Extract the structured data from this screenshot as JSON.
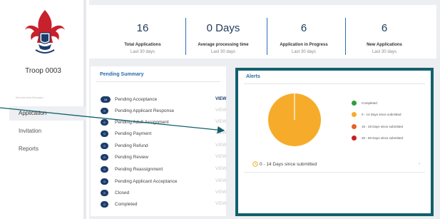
{
  "sidebar": {
    "troop_name": "Troop 0003",
    "section_label": "Membership Manager",
    "items": [
      {
        "label": "Application",
        "active": true
      },
      {
        "label": "Invitation",
        "active": false
      },
      {
        "label": "Reports",
        "active": false
      }
    ]
  },
  "stats": [
    {
      "value": "16",
      "label": "Total Applications",
      "sub": "Last 30 days"
    },
    {
      "value": "0 Days",
      "label": "Average processing time",
      "sub": "Last 30 days"
    },
    {
      "value": "6",
      "label": "Application in Progress",
      "sub": "Last 30 days"
    },
    {
      "value": "6",
      "label": "New Applications",
      "sub": "Last 30 days"
    }
  ],
  "pending": {
    "title": "Pending Summary",
    "rows": [
      {
        "count": "16",
        "label": "Pending Acceptance",
        "view": "VIEW",
        "active": true
      },
      {
        "count": "0",
        "label": "Pending Applicant Response",
        "view": "VIEW",
        "active": false
      },
      {
        "count": "0",
        "label": "Pending Adult Assignment",
        "view": "VIEW",
        "active": false
      },
      {
        "count": "0",
        "label": "Pending Payment",
        "view": "VIEW",
        "active": false
      },
      {
        "count": "0",
        "label": "Pending Refund",
        "view": "VIEW",
        "active": false
      },
      {
        "count": "0",
        "label": "Pending Review",
        "view": "VIEW",
        "active": false
      },
      {
        "count": "0",
        "label": "Pending Reassignment",
        "view": "VIEW",
        "active": false
      },
      {
        "count": "0",
        "label": "Pending Applicant Acceptance",
        "view": "VIEW",
        "active": false
      },
      {
        "count": "0",
        "label": "Closed",
        "view": "VIEW",
        "active": false
      },
      {
        "count": "0",
        "label": "Completed",
        "view": "VIEW",
        "active": false
      }
    ]
  },
  "alerts": {
    "title": "Alerts",
    "legend": [
      {
        "label": "Completed",
        "color": "#2e9e3f"
      },
      {
        "label": "0 - 14 Days since submitted",
        "color": "#f6ac2a"
      },
      {
        "label": "15 - 25 Days since submitted",
        "color": "#e9602a"
      },
      {
        "label": "26 - 60 Days since submitted",
        "color": "#c62020"
      }
    ],
    "footer_text": "0 - 14 Days since submitted",
    "chevron": "›"
  },
  "colors": {
    "accent_teal": "#12606d",
    "navy": "#1d3c6b",
    "pie_main": "#f6ac2a"
  }
}
